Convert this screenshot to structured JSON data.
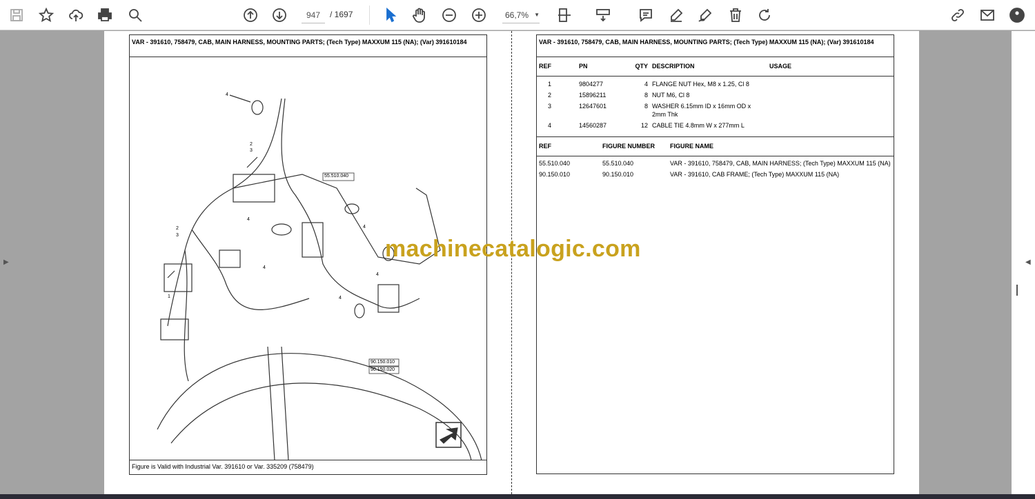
{
  "toolbar": {
    "page_current": "947",
    "page_total": "/ 1697",
    "zoom": "66,7%",
    "icons": [
      "save-icon",
      "bookmark-star-icon",
      "upload-cloud-icon",
      "print-icon",
      "find-icon",
      "previous-page-icon",
      "next-page-icon",
      "select-cursor-icon",
      "hand-tool-icon",
      "zoom-out-icon",
      "zoom-in-icon",
      "fit-page-icon",
      "scroll-mode-icon",
      "comment-icon",
      "highlight-icon",
      "sign-icon",
      "delete-icon",
      "rotate-icon",
      "share-link-icon",
      "email-icon",
      "account-icon"
    ]
  },
  "left": {
    "title": "VAR - 391610, 758479, CAB, MAIN HARNESS, MOUNTING PARTS; (Tech Type) MAXXUM 115 (NA); (Var) 391610184",
    "callouts": [
      "4",
      "2",
      "3",
      "55.510.040",
      "4",
      "4",
      "2",
      "3",
      "4",
      "4",
      "4",
      "1",
      "90.150.010",
      "90.150.020"
    ],
    "footer": "Figure is Valid with Industrial Var. 391610 or Var. 335209 (758479)"
  },
  "right": {
    "title": "VAR - 391610, 758479, CAB, MAIN HARNESS, MOUNTING PARTS; (Tech Type) MAXXUM 115 (NA); (Var) 391610184",
    "parts_headers": [
      "REF",
      "PN",
      "QTY",
      "DESCRIPTION",
      "USAGE"
    ],
    "parts": [
      [
        "1",
        "9804277",
        "4",
        "FLANGE NUT Hex, M8 x 1.25, Cl 8",
        ""
      ],
      [
        "2",
        "15896211",
        "8",
        "NUT M6, Cl 8",
        ""
      ],
      [
        "3",
        "12647601",
        "8",
        "WASHER 6.15mm ID x 16mm OD x 2mm Thk",
        ""
      ],
      [
        "4",
        "14560287",
        "12",
        "CABLE TIE 4.8mm W x 277mm L",
        ""
      ]
    ],
    "fig_headers": [
      "REF",
      "FIGURE NUMBER",
      "FIGURE NAME"
    ],
    "figs": [
      [
        "55.510.040",
        "55.510.040",
        "VAR - 391610, 758479, CAB, MAIN HARNESS; (Tech Type) MAXXUM 115 (NA)"
      ],
      [
        "90.150.010",
        "90.150.010",
        "VAR - 391610, CAB FRAME; (Tech Type) MAXXUM 115 (NA)"
      ]
    ]
  },
  "watermark": "machinecatalogic.com"
}
